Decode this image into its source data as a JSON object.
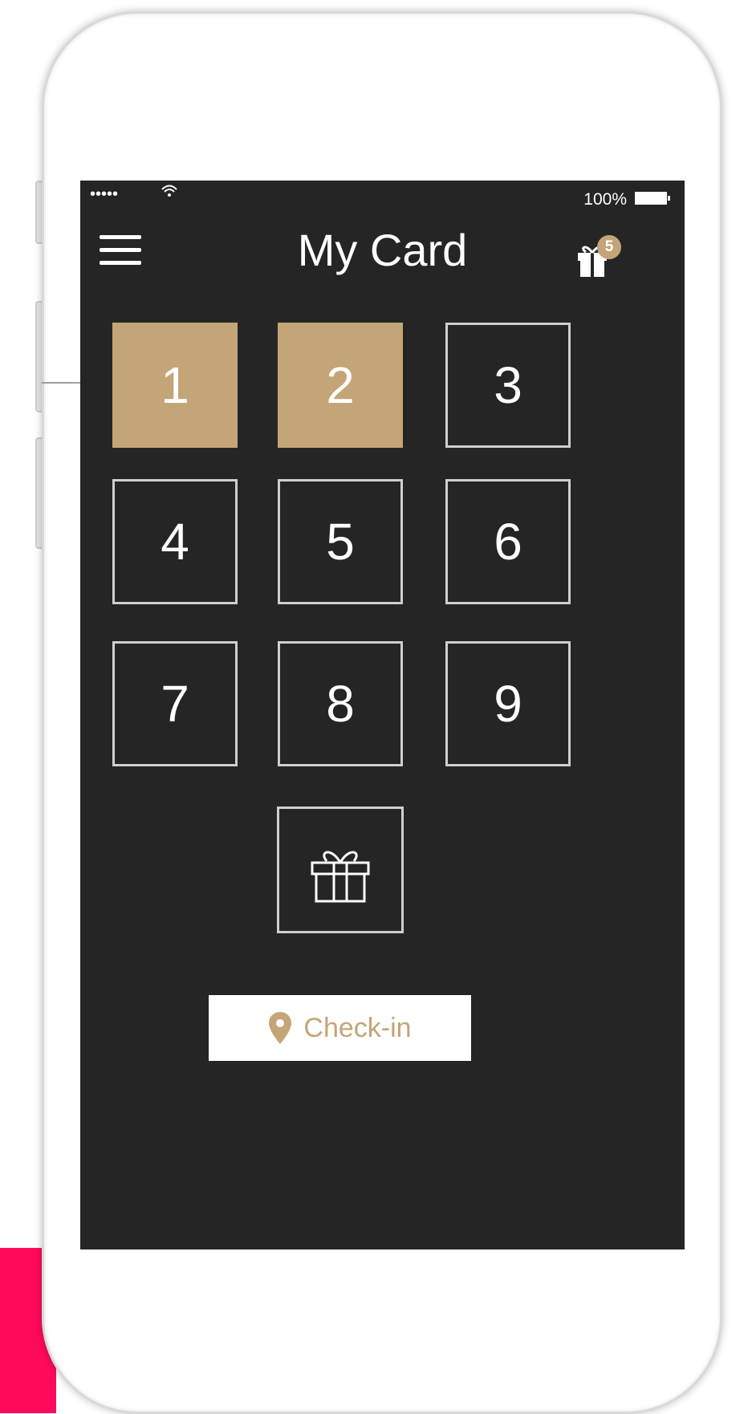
{
  "status_bar": {
    "signal": "•••••",
    "battery_pct": "100%"
  },
  "header": {
    "title": "My Card",
    "menu_icon": "hamburger-menu-icon",
    "reward_icon": "gift-icon",
    "reward_badge": "5"
  },
  "card": {
    "stamps": [
      {
        "label": "1",
        "stamped": true
      },
      {
        "label": "2",
        "stamped": true
      },
      {
        "label": "3",
        "stamped": false
      },
      {
        "label": "4",
        "stamped": false
      },
      {
        "label": "5",
        "stamped": false
      },
      {
        "label": "6",
        "stamped": false
      },
      {
        "label": "7",
        "stamped": false
      },
      {
        "label": "8",
        "stamped": false
      },
      {
        "label": "9",
        "stamped": false
      }
    ],
    "reward_icon": "gift-icon"
  },
  "checkin": {
    "label": "Check-in",
    "icon": "map-pin-icon"
  },
  "colors": {
    "screen_bg": "#262525",
    "accent": "#c4a577",
    "cell_border": "#cfcfcf",
    "side_block": "#ff0a5a"
  }
}
